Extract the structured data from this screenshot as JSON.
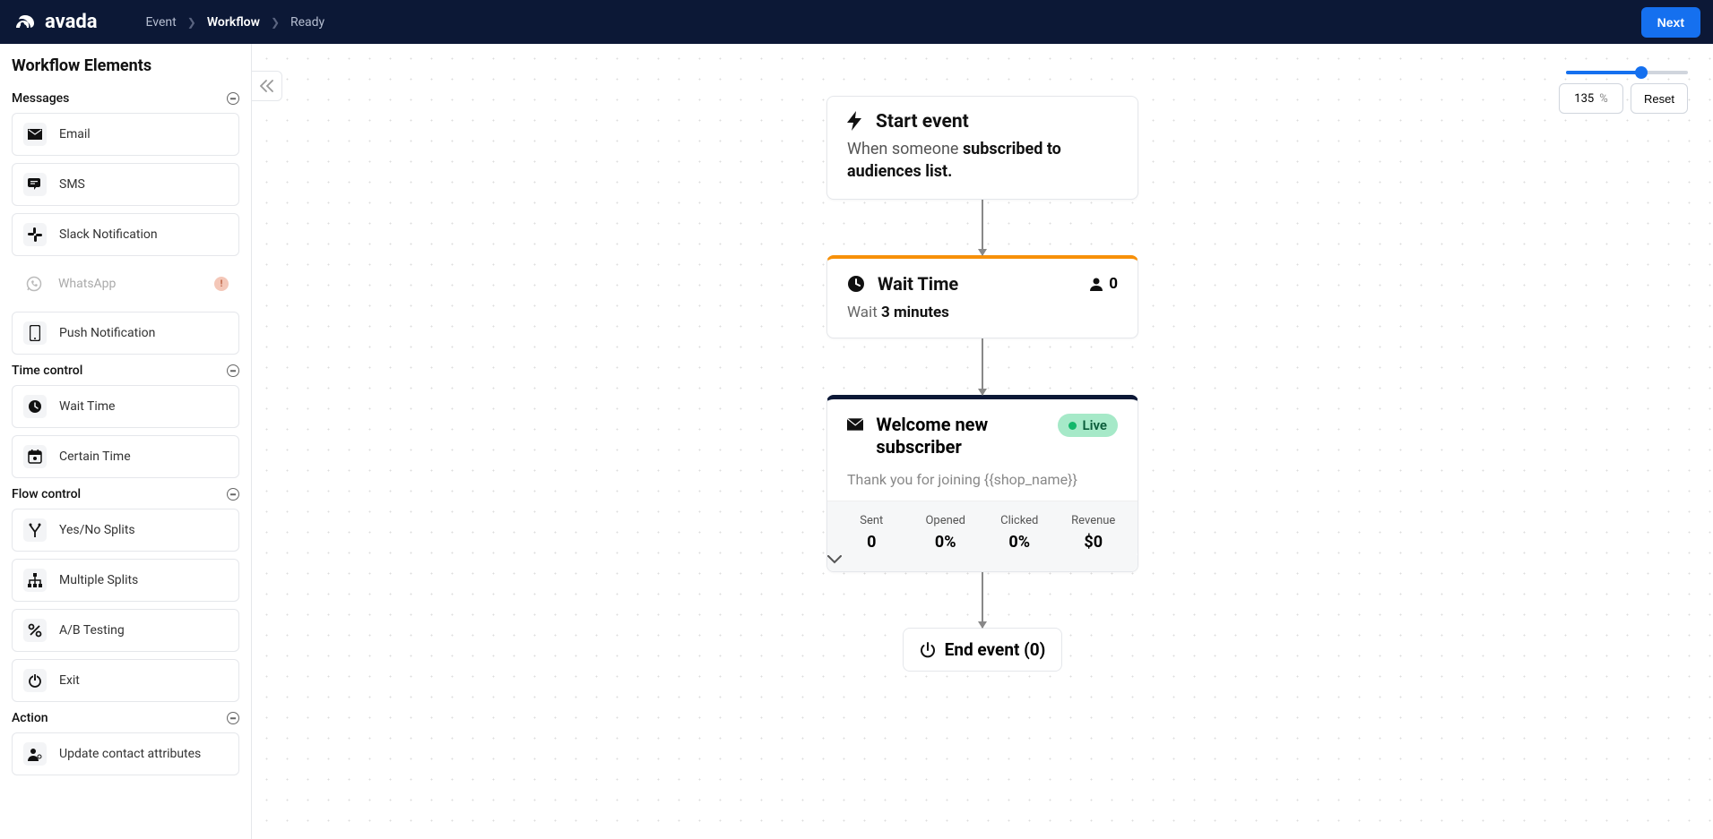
{
  "header": {
    "logo": "avada",
    "breadcrumb": [
      "Event",
      "Workflow",
      "Ready"
    ],
    "active_crumb_index": 1,
    "next_label": "Next"
  },
  "sidebar": {
    "title": "Workflow Elements",
    "sections": [
      {
        "title": "Messages",
        "items": [
          {
            "label": "Email",
            "icon": "email-icon"
          },
          {
            "label": "SMS",
            "icon": "sms-icon"
          },
          {
            "label": "Slack Notification",
            "icon": "slack-icon"
          },
          {
            "label": "WhatsApp",
            "icon": "whatsapp-icon",
            "disabled": true,
            "warn": true
          },
          {
            "label": "Push Notification",
            "icon": "phone-icon"
          }
        ]
      },
      {
        "title": "Time control",
        "items": [
          {
            "label": "Wait Time",
            "icon": "clock-icon"
          },
          {
            "label": "Certain Time",
            "icon": "calendar-icon"
          }
        ]
      },
      {
        "title": "Flow control",
        "items": [
          {
            "label": "Yes/No Splits",
            "icon": "split-icon"
          },
          {
            "label": "Multiple Splits",
            "icon": "tree-icon"
          },
          {
            "label": "A/B Testing",
            "icon": "percent-icon"
          },
          {
            "label": "Exit",
            "icon": "power-icon"
          }
        ]
      },
      {
        "title": "Action",
        "items": [
          {
            "label": "Update contact attributes",
            "icon": "user-cog-icon"
          }
        ]
      }
    ]
  },
  "zoom": {
    "value": "135",
    "percent_label": "%",
    "reset_label": "Reset",
    "fill_pct": 62
  },
  "nodes": {
    "start": {
      "title": "Start event",
      "sub_prefix": "When someone ",
      "sub_bold": "subscribed to audiences list."
    },
    "wait": {
      "title": "Wait Time",
      "count": "0",
      "text_prefix": "Wait ",
      "text_bold": "3 minutes"
    },
    "email": {
      "title": "Welcome new subscriber",
      "badge": "Live",
      "sub": "Thank you for joining {{shop_name}}",
      "stats": [
        {
          "label": "Sent",
          "value": "0"
        },
        {
          "label": "Opened",
          "value": "0%"
        },
        {
          "label": "Clicked",
          "value": "0%"
        },
        {
          "label": "Revenue",
          "value": "$0"
        }
      ]
    },
    "end": {
      "label": "End event (0)"
    }
  }
}
